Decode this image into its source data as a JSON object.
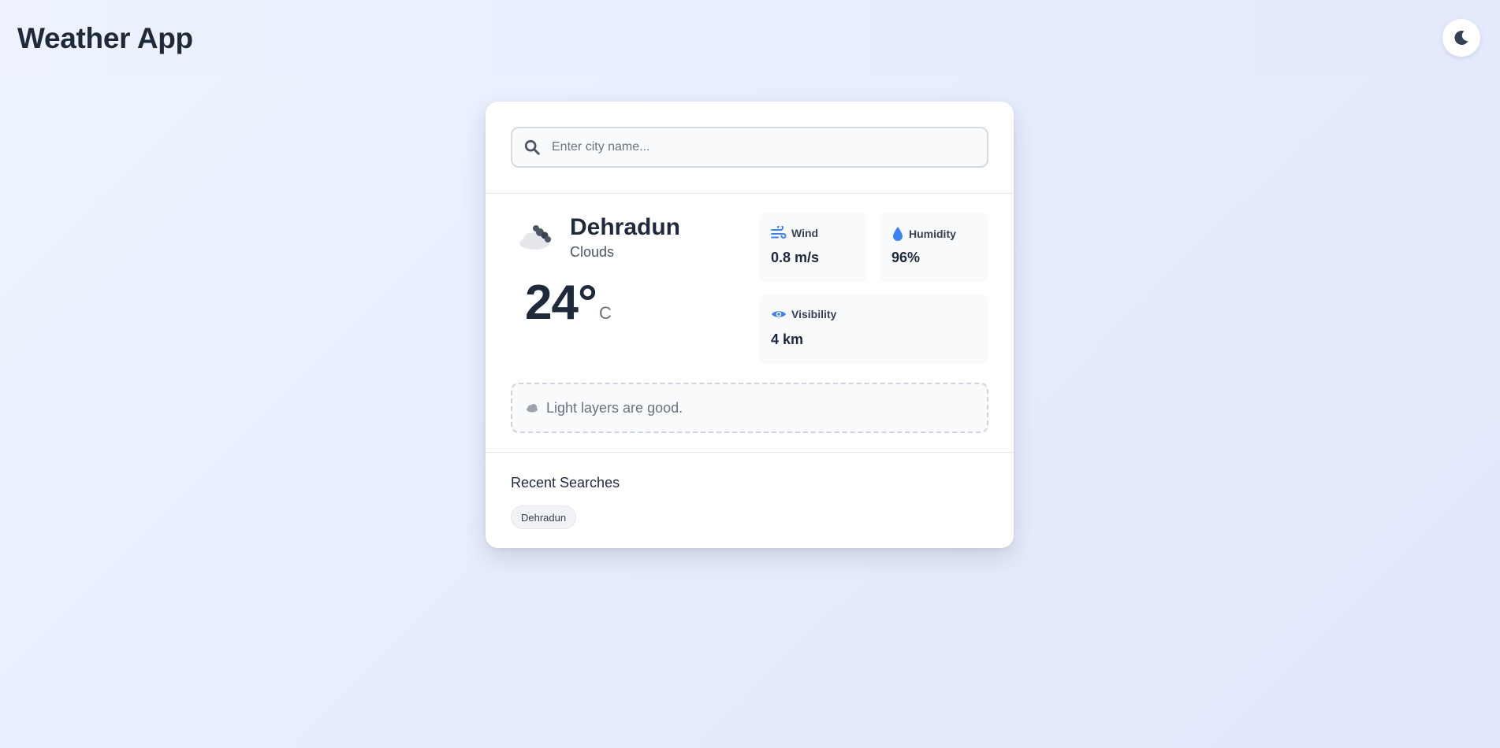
{
  "app": {
    "title": "Weather App"
  },
  "search": {
    "placeholder": "Enter city name...",
    "value": ""
  },
  "weather": {
    "city": "Dehradun",
    "condition": "Clouds",
    "temperature": "24°",
    "unit": "C",
    "icon": "clouds-icon"
  },
  "stats": {
    "wind": {
      "label": "Wind",
      "value": "0.8 m/s",
      "icon": "wind-icon"
    },
    "humidity": {
      "label": "Humidity",
      "value": "96%",
      "icon": "droplet-icon"
    },
    "visibility": {
      "label": "Visibility",
      "value": "4 km",
      "icon": "eye-icon"
    }
  },
  "tip": {
    "text": "Light layers are good.",
    "icon": "cloud-icon"
  },
  "recent": {
    "title": "Recent Searches",
    "items": [
      "Dehradun"
    ]
  },
  "colors": {
    "accent": "#3b82f6",
    "text": "#1e293b",
    "muted": "#6b7280"
  }
}
